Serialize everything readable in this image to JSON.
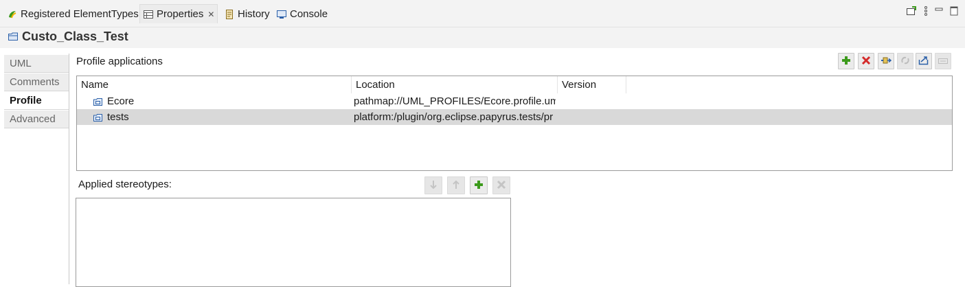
{
  "tabs": [
    {
      "label": "Registered ElementTypes",
      "icon": "registered-elementtypes-icon"
    },
    {
      "label": "Properties",
      "icon": "properties-icon",
      "active": true
    },
    {
      "label": "History",
      "icon": "history-icon"
    },
    {
      "label": "Console",
      "icon": "console-icon"
    }
  ],
  "header": {
    "title": "Custo_Class_Test",
    "icon": "class-icon"
  },
  "sidebar": {
    "items": [
      {
        "label": "UML"
      },
      {
        "label": "Comments"
      },
      {
        "label": "Profile",
        "active": true
      },
      {
        "label": "Advanced"
      }
    ]
  },
  "profile_applications": {
    "label": "Profile applications",
    "columns": [
      "Name",
      "Location",
      "Version"
    ],
    "rows": [
      {
        "name": "Ecore",
        "location": "pathmap://UML_PROFILES/Ecore.profile.uml",
        "version": ""
      },
      {
        "name": "tests",
        "location": "platform:/plugin/org.eclipse.papyrus.tests/pr",
        "version": "",
        "selected": true
      }
    ],
    "toolbar": [
      "add-icon",
      "remove-icon",
      "browse-icon",
      "refresh-icon",
      "export-icon",
      "keyboard-icon"
    ]
  },
  "applied_stereotypes": {
    "label": "Applied stereotypes:",
    "toolbar": [
      "move-down-icon",
      "move-up-icon",
      "add-icon",
      "remove-icon"
    ]
  },
  "colors": {
    "add_green": "#3c9a1c",
    "remove_red": "#d42a2a",
    "selection_gray": "#d9d9d9",
    "accent_blue": "#2a5fa8"
  }
}
